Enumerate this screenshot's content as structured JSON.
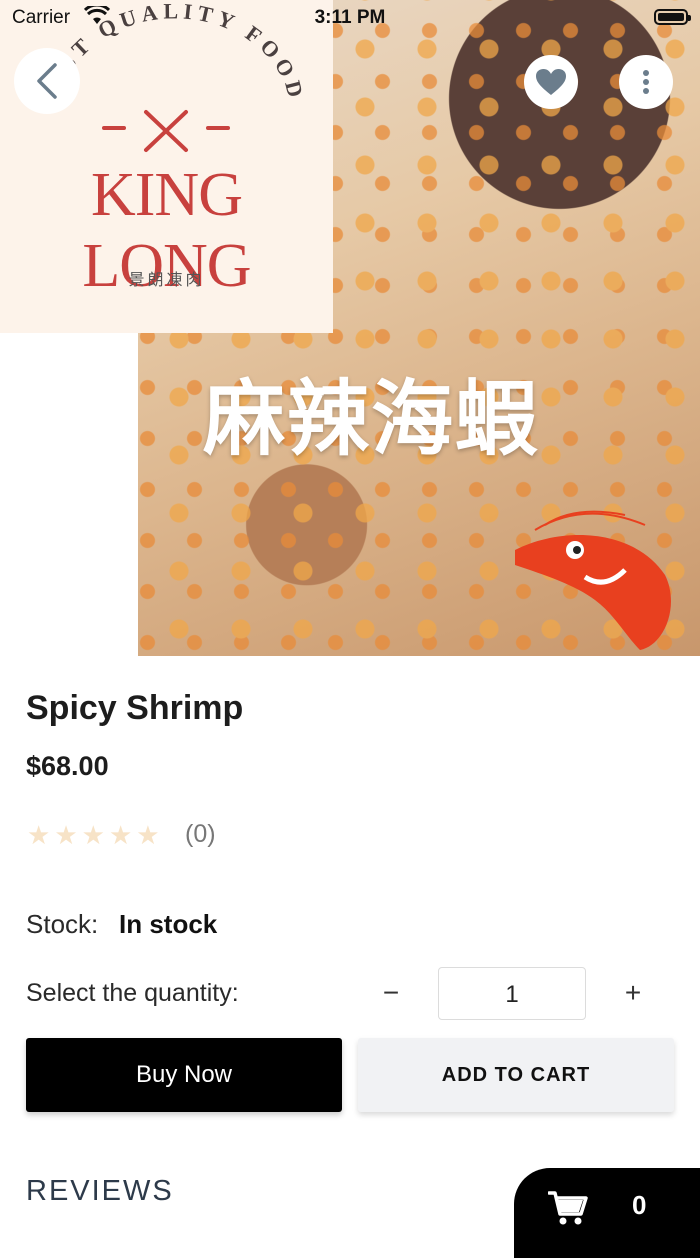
{
  "status_bar": {
    "carrier": "Carrier",
    "time": "3:11 PM"
  },
  "hero": {
    "logo_arc_text": "BEST QUALITY FOOD",
    "logo_name": "KING LONG",
    "logo_subtitle": "景朗凍肉",
    "image_text": "麻辣海蝦"
  },
  "product": {
    "title": "Spicy Shrimp",
    "price": "$68.00",
    "rating_stars": 0,
    "rating_count": "(0)",
    "stock_label": "Stock:",
    "stock_value": "In stock",
    "quantity_label": "Select the quantity:",
    "quantity_minus": "−",
    "quantity_value": "1",
    "quantity_plus": "+"
  },
  "actions": {
    "buy_now": "Buy Now",
    "add_to_cart": "ADD TO CART"
  },
  "reviews": {
    "heading": "REVIEWS"
  },
  "cart": {
    "count": "0"
  },
  "colors": {
    "accent": "#000000",
    "logo_red": "#c8413e",
    "star_empty": "#f7e3c7"
  }
}
